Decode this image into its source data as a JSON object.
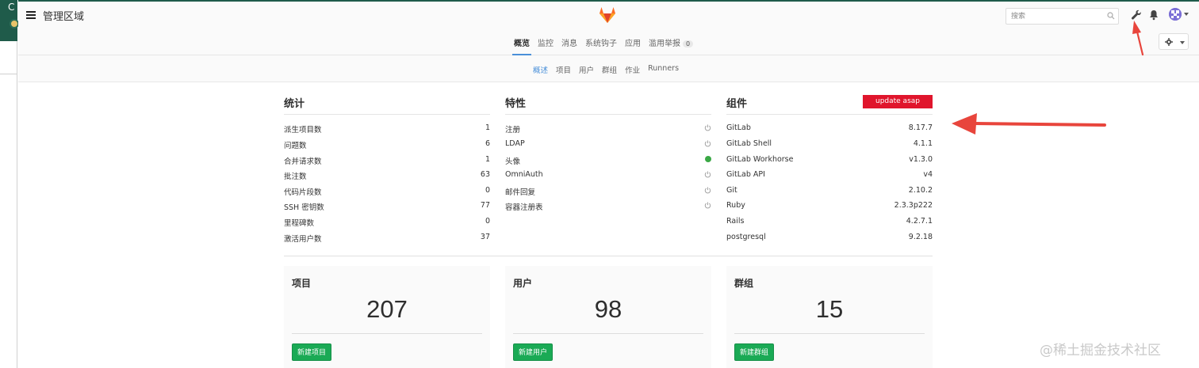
{
  "header": {
    "title": "管理区域",
    "search_placeholder": "搜索"
  },
  "top_nav": {
    "tabs": [
      {
        "label": "概览",
        "active": true
      },
      {
        "label": "监控"
      },
      {
        "label": "消息"
      },
      {
        "label": "系统钩子"
      },
      {
        "label": "应用"
      },
      {
        "label": "滥用举报",
        "count": "0"
      }
    ]
  },
  "sub_nav": {
    "items": [
      {
        "label": "概述",
        "active": true
      },
      {
        "label": "项目"
      },
      {
        "label": "用户"
      },
      {
        "label": "群组"
      },
      {
        "label": "作业"
      },
      {
        "label": "Runners"
      }
    ]
  },
  "stats": {
    "title": "统计",
    "rows": [
      {
        "label": "派生项目数",
        "value": "1"
      },
      {
        "label": "问题数",
        "value": "6"
      },
      {
        "label": "合并请求数",
        "value": "1"
      },
      {
        "label": "批注数",
        "value": "63"
      },
      {
        "label": "代码片段数",
        "value": "0"
      },
      {
        "label": "SSH 密钥数",
        "value": "77"
      },
      {
        "label": "里程碑数",
        "value": "0"
      },
      {
        "label": "激活用户数",
        "value": "37"
      }
    ]
  },
  "features": {
    "title": "特性",
    "rows": [
      {
        "label": "注册",
        "status": "off"
      },
      {
        "label": "LDAP",
        "status": "off"
      },
      {
        "label": "头像",
        "status": "on"
      },
      {
        "label": "OmniAuth",
        "status": "off"
      },
      {
        "label": "邮件回复",
        "status": "off"
      },
      {
        "label": "容器注册表",
        "status": "off"
      }
    ]
  },
  "components": {
    "title": "组件",
    "update_label": "update asap",
    "rows": [
      {
        "label": "GitLab",
        "value": "8.17.7"
      },
      {
        "label": "GitLab Shell",
        "value": "4.1.1"
      },
      {
        "label": "GitLab Workhorse",
        "value": "v1.3.0"
      },
      {
        "label": "GitLab API",
        "value": "v4"
      },
      {
        "label": "Git",
        "value": "2.10.2"
      },
      {
        "label": "Ruby",
        "value": "2.3.3p222"
      },
      {
        "label": "Rails",
        "value": "4.2.7.1"
      },
      {
        "label": "postgresql",
        "value": "9.2.18"
      }
    ]
  },
  "cards": [
    {
      "title": "项目",
      "count": "207",
      "button": "新建项目"
    },
    {
      "title": "用户",
      "count": "98",
      "button": "新建用户"
    },
    {
      "title": "群组",
      "count": "15",
      "button": "新建群组"
    }
  ],
  "colors": {
    "accent": "#4a90d9",
    "update": "#e0152c",
    "success": "#1aaa55",
    "annotation_arrow": "#e8453c"
  },
  "watermark": "@稀土掘金技术社区"
}
